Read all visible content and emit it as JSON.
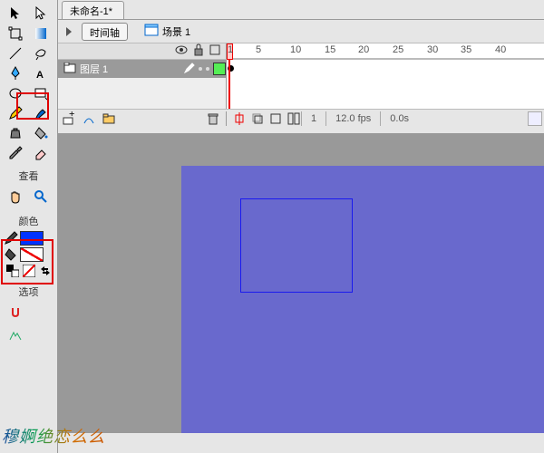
{
  "document": {
    "tab_title": "未命名-1*"
  },
  "topbar": {
    "timeline_label": "时间轴",
    "scene_label": "场景 1"
  },
  "toolbox": {
    "sections": {
      "view": "查看",
      "color": "颜色",
      "options": "选项"
    },
    "stroke_color": "#0033ff",
    "fill_color": "none"
  },
  "timeline": {
    "layer_name": "图层 1",
    "ruler_ticks": [
      "1",
      "5",
      "10",
      "15",
      "20",
      "25",
      "30",
      "35",
      "40"
    ],
    "status": {
      "frame": "1",
      "fps": "12.0 fps",
      "time": "0.0s"
    }
  },
  "watermark": "穆婀绝恋么么"
}
